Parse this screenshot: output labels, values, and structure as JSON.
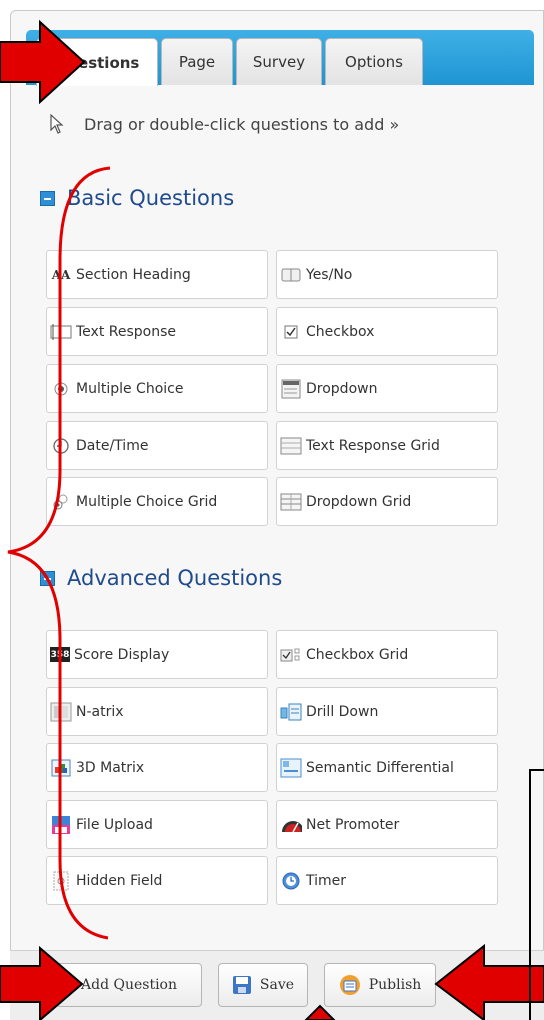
{
  "tabs": [
    {
      "label": "Questions",
      "active": true
    },
    {
      "label": "Page",
      "active": false
    },
    {
      "label": "Survey",
      "active": false
    },
    {
      "label": "Options",
      "active": false
    }
  ],
  "hint": {
    "text": "Drag or double-click questions to add »",
    "icon": "cursor-arrow-icon"
  },
  "basic": {
    "title": "Basic Questions",
    "items": [
      {
        "label": "Section Heading",
        "icon": "section-heading-icon"
      },
      {
        "label": "Yes/No",
        "icon": "toggle-icon"
      },
      {
        "label": "Text Response",
        "icon": "text-box-icon"
      },
      {
        "label": "Checkbox",
        "icon": "checkbox-icon"
      },
      {
        "label": "Multiple Choice",
        "icon": "radio-icon"
      },
      {
        "label": "Dropdown",
        "icon": "dropdown-icon"
      },
      {
        "label": "Date/Time",
        "icon": "clock-icon"
      },
      {
        "label": "Text Response Grid",
        "icon": "text-grid-icon"
      },
      {
        "label": "Multiple Choice Grid",
        "icon": "radio-grid-icon"
      },
      {
        "label": "Dropdown Grid",
        "icon": "dropdown-grid-icon"
      }
    ]
  },
  "advanced": {
    "title": "Advanced Questions",
    "items": [
      {
        "label": "Score Display",
        "icon": "score-icon"
      },
      {
        "label": "Checkbox Grid",
        "icon": "checkbox-grid-icon"
      },
      {
        "label": "N-atrix",
        "icon": "matrix-icon"
      },
      {
        "label": "Drill Down",
        "icon": "drill-down-icon"
      },
      {
        "label": "3D Matrix",
        "icon": "3d-matrix-icon"
      },
      {
        "label": "Semantic Differential",
        "icon": "semantic-icon"
      },
      {
        "label": "File Upload",
        "icon": "upload-icon"
      },
      {
        "label": "Net Promoter",
        "icon": "gauge-icon"
      },
      {
        "label": "Hidden Field",
        "icon": "hidden-field-icon"
      },
      {
        "label": "Timer",
        "icon": "timer-icon"
      }
    ]
  },
  "score_icon_text": "358",
  "section_heading_icon_text": "AA",
  "footer": {
    "add_question": "Add Question",
    "save": "Save",
    "publish": "Publish"
  },
  "colors": {
    "tab_bar": "#1e95d2",
    "section_title": "#1f4a8c",
    "annotation_red": "#e00000"
  }
}
